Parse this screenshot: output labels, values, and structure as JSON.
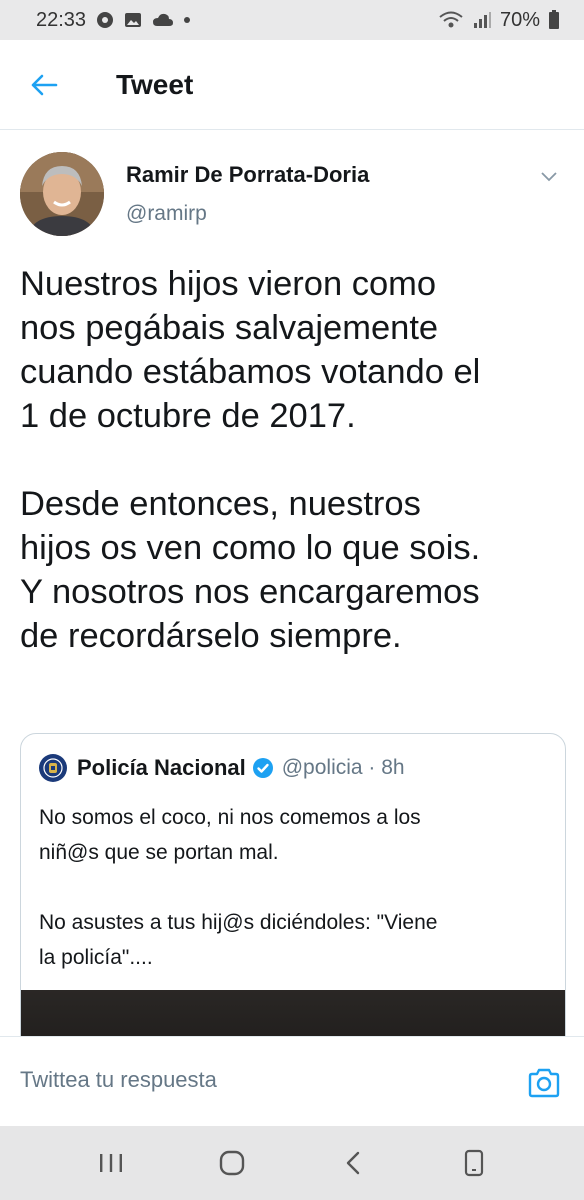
{
  "status_bar": {
    "time": "22:33",
    "battery": "70%"
  },
  "header": {
    "title": "Tweet"
  },
  "tweet": {
    "author_name": "Ramir De Porrata-Doria",
    "author_handle": "@ramirp",
    "paragraphs": [
      [
        "Nuestros hijos vieron como",
        "nos pegábais salvajemente",
        "cuando estábamos votando el",
        "1 de octubre de 2017."
      ],
      [
        "Desde entonces, nuestros",
        "hijos os ven como lo que sois.",
        "Y nosotros nos encargaremos",
        "de recordárselo siempre."
      ]
    ]
  },
  "quoted_tweet": {
    "name": "Policía Nacional",
    "handle_time": "@policia · 8h",
    "paragraphs": [
      [
        "No somos el coco, ni nos comemos a los",
        "niñ@s que se portan mal."
      ],
      [
        "No asustes a tus hij@s diciéndoles: \"Viene",
        "la policía\"...."
      ]
    ]
  },
  "reply_bar": {
    "placeholder": "Twittea tu respuesta"
  },
  "colors": {
    "accent": "#1da1f2",
    "text": "#14171a",
    "secondary": "#657786",
    "border": "#ccd6dd"
  },
  "icons": {
    "back": "arrow-left-icon",
    "caret": "chevron-down-icon",
    "verified": "verified-badge-icon",
    "camera": "camera-icon",
    "nav_recents": "recents-icon",
    "nav_home": "home-icon",
    "nav_back": "back-icon"
  }
}
